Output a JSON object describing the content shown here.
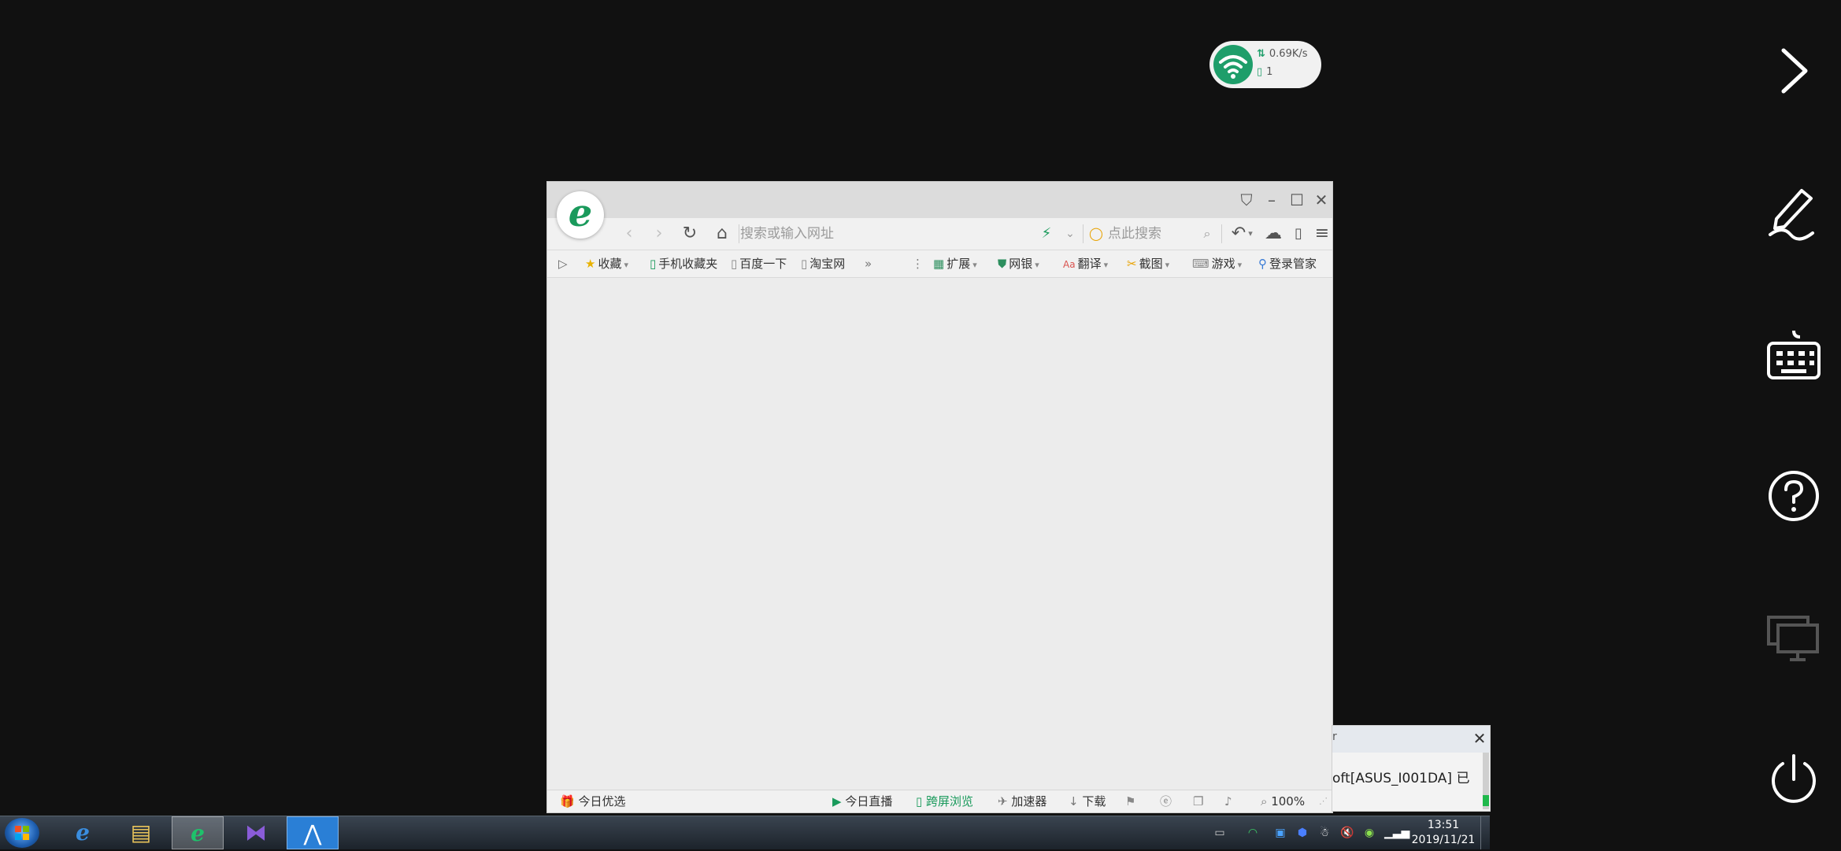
{
  "network_widget": {
    "speed": "0.69K/s",
    "devices": "1",
    "wifi_icon": "wifi-icon",
    "accent": "#1e9e6a"
  },
  "side_panel": {
    "buttons": [
      {
        "name": "expand-chevron-icon"
      },
      {
        "name": "pen-icon"
      },
      {
        "name": "keyboard-icon"
      },
      {
        "name": "help-icon"
      },
      {
        "name": "screen-mirror-icon"
      },
      {
        "name": "power-icon"
      }
    ]
  },
  "browser": {
    "address_placeholder": "搜索或输入网址",
    "search_placeholder": "点此搜索",
    "bookmarks": {
      "favorites": "收藏",
      "mobile_favorites": "手机收藏夹",
      "baidu": "百度一下",
      "taobao": "淘宝网",
      "more": "»"
    },
    "tools": {
      "extensions": "扩展",
      "bank": "网银",
      "translate": "翻译",
      "screenshot": "截图",
      "games": "游戏",
      "login_manager": "登录管家"
    },
    "status": {
      "today_picks": "今日优选",
      "today_live": "今日直播",
      "cross_screen": "跨屏浏览",
      "accelerator": "加速器",
      "download": "下载",
      "zoom": "100%"
    },
    "brand_color": "#1a9a5c"
  },
  "notification": {
    "title": "r",
    "text": "oft[ASUS_I001DA] 已"
  },
  "taskbar": {
    "time": "13:51",
    "date": "2019/11/21"
  }
}
